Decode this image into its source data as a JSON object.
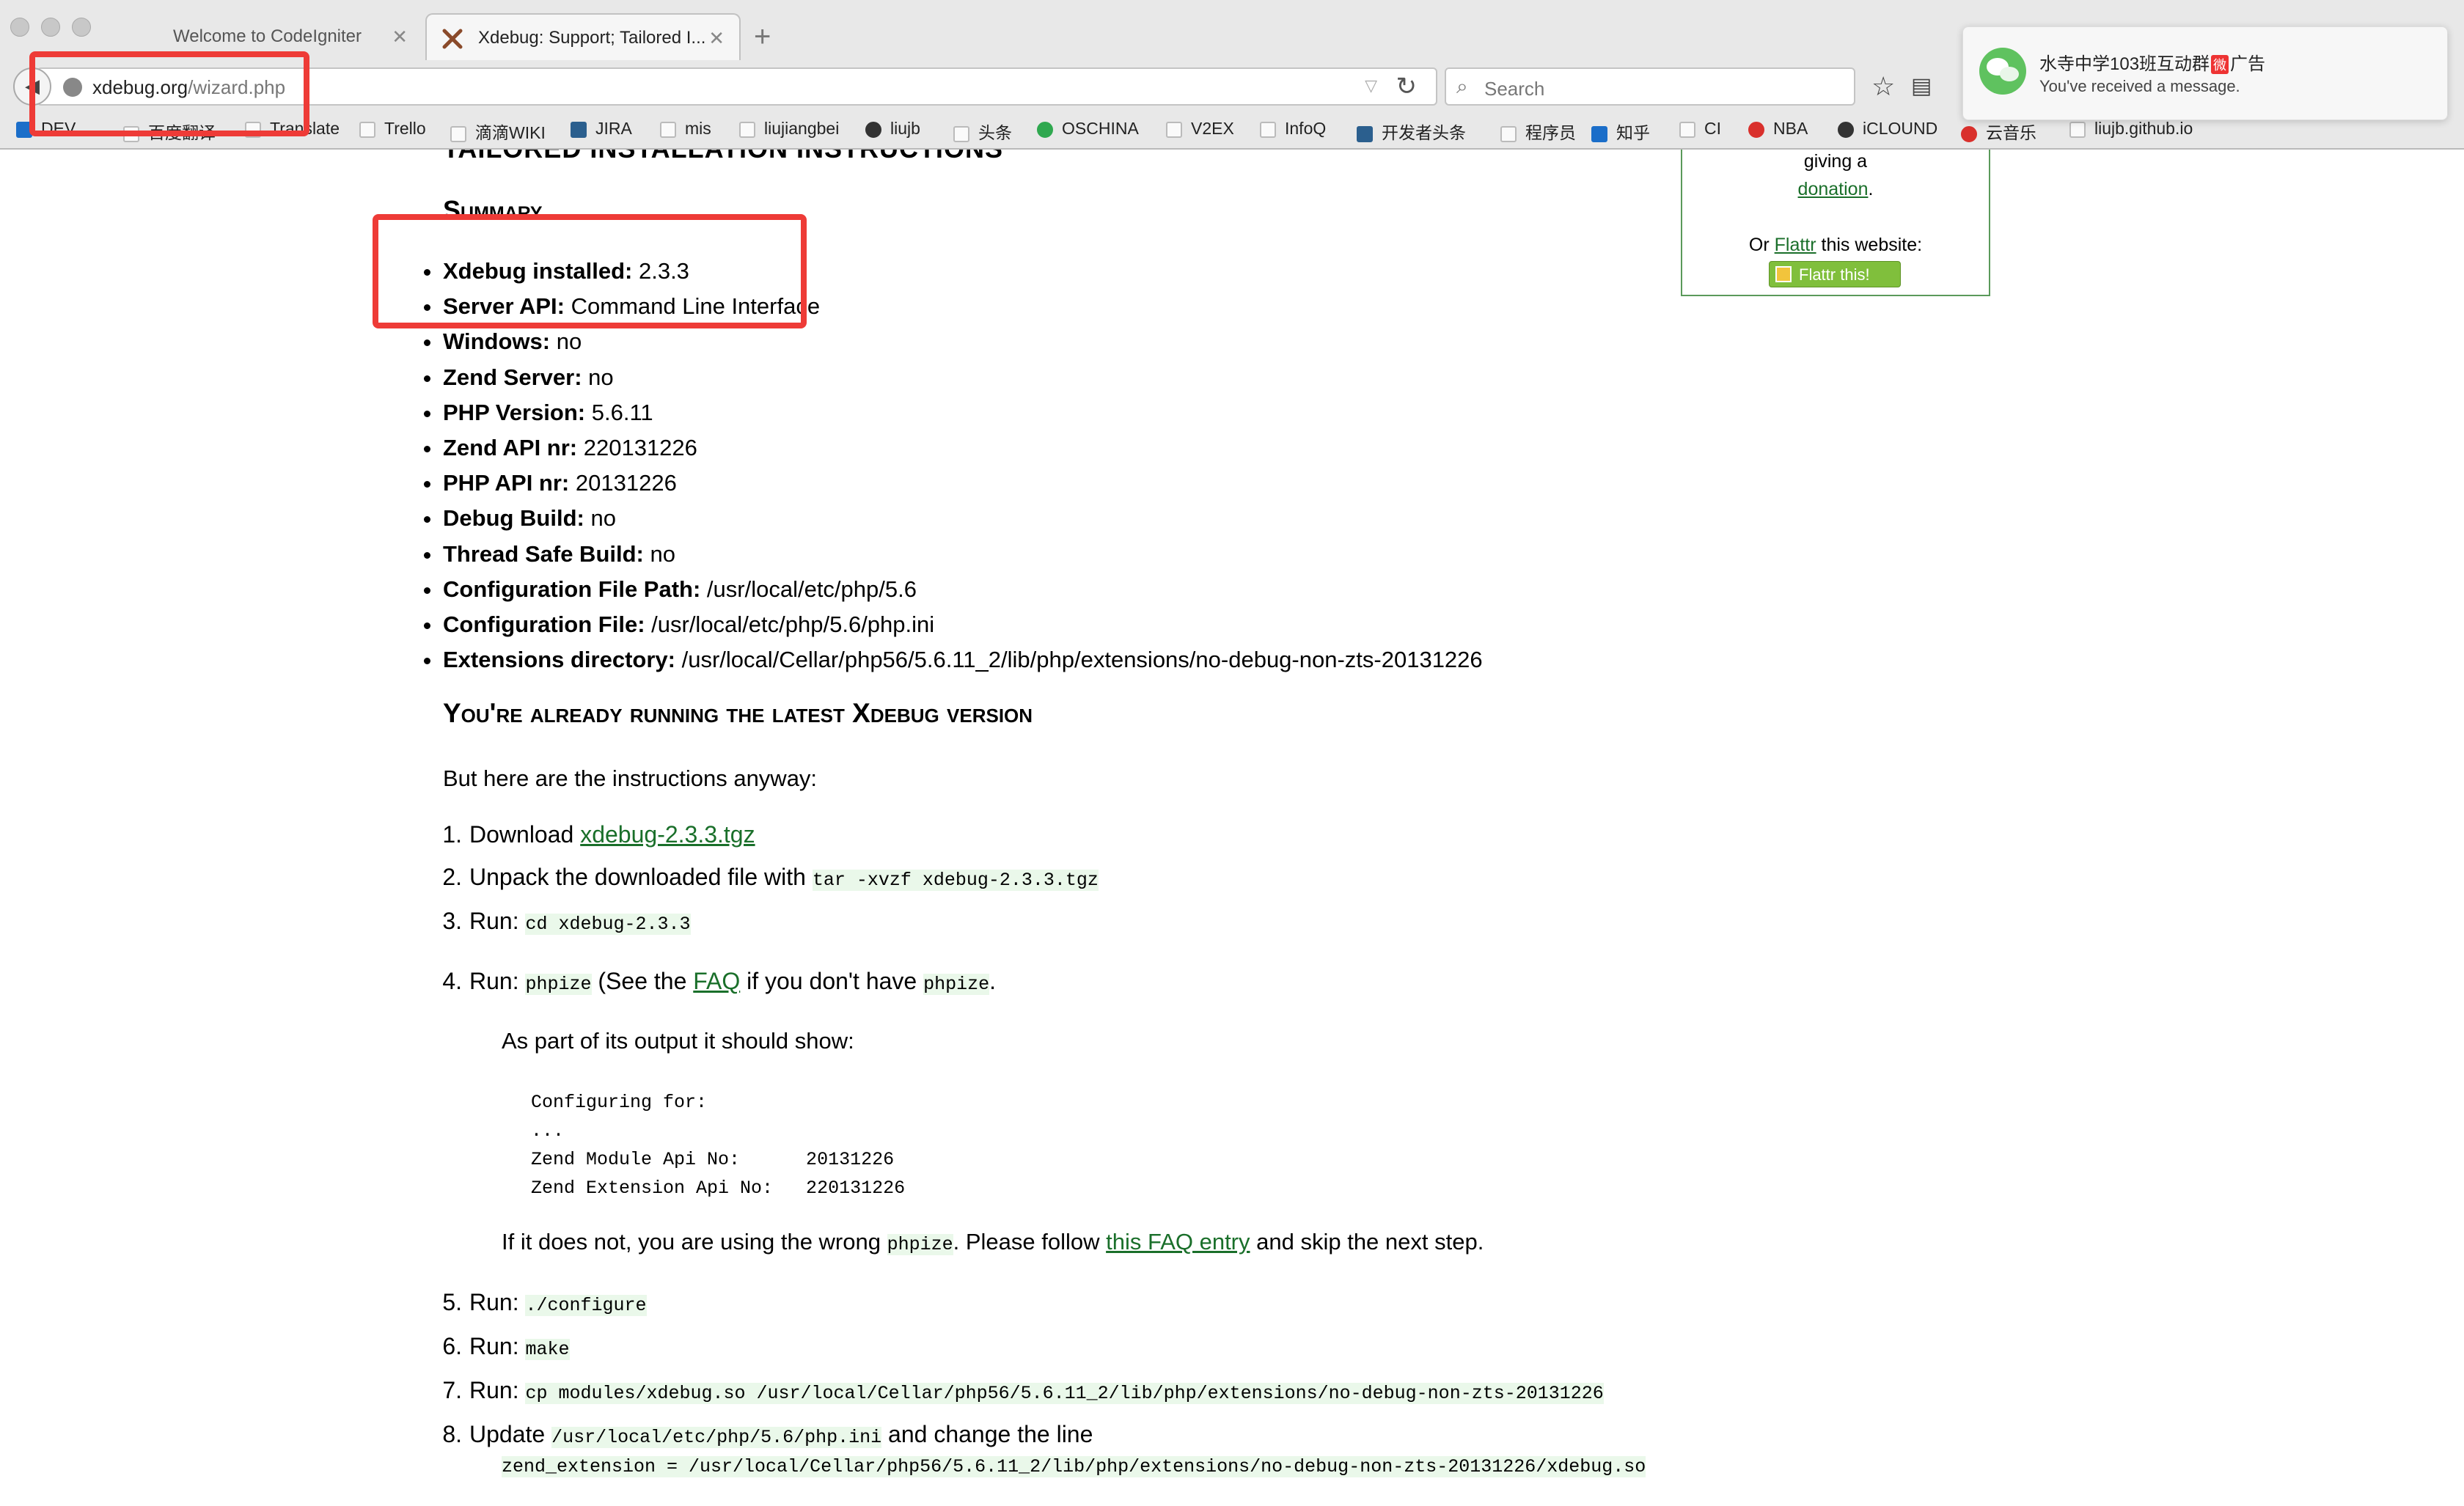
{
  "browser": {
    "tabs": [
      {
        "title": "Welcome to CodeIgniter",
        "close": "✕"
      },
      {
        "title": "Xdebug: Support; Tailored I...",
        "close": "✕"
      }
    ],
    "new_tab": "+",
    "url_host": "xdebug.org",
    "url_path": "/wizard.php",
    "search_placeholder": "Search",
    "bookmarks": [
      "DEV",
      "百度翻译",
      "Translate",
      "Trello",
      "滴滴WIKI",
      "JIRA",
      "mis",
      "liujiangbei",
      "liujb",
      "头条",
      "OSCHINA",
      "V2EX",
      "InfoQ",
      "开发者头条",
      "程序员",
      "知乎",
      "CI",
      "NBA",
      "iCLOUND",
      "云音乐",
      "liujb.github.io"
    ]
  },
  "notification": {
    "title_pre": "水寺中学103班互动群",
    "badge": "微",
    "title_post": "广告",
    "message": "You've received a message."
  },
  "page": {
    "partial_heading": "TAILORED INSTALLATION INSTRUCTIONS",
    "summary_heading": "Summary",
    "summary": [
      {
        "label": "Xdebug installed:",
        "value": " 2.3.3"
      },
      {
        "label": "Server API:",
        "value": " Command Line Interface"
      },
      {
        "label": "Windows:",
        "value": " no"
      },
      {
        "label": "Zend Server:",
        "value": " no"
      },
      {
        "label": "PHP Version:",
        "value": " 5.6.11"
      },
      {
        "label": "Zend API nr:",
        "value": " 220131226"
      },
      {
        "label": "PHP API nr:",
        "value": " 20131226"
      },
      {
        "label": "Debug Build:",
        "value": " no"
      },
      {
        "label": "Thread Safe Build:",
        "value": " no"
      },
      {
        "label": "Configuration File Path:",
        "value": " /usr/local/etc/php/5.6"
      },
      {
        "label": "Configuration File:",
        "value": " /usr/local/etc/php/5.6/php.ini"
      },
      {
        "label": "Extensions directory:",
        "value": " /usr/local/Cellar/php56/5.6.11_2/lib/php/extensions/no-debug-non-zts-20131226"
      }
    ],
    "latest_heading": "You're already running the latest Xdebug version",
    "intro": "But here are the instructions anyway:",
    "steps": {
      "s1_num": "1.",
      "s1_text": "Download ",
      "s1_link": "xdebug-2.3.3.tgz",
      "s2_num": "2.",
      "s2_text": "Unpack the downloaded file with ",
      "s2_code": "tar -xvzf xdebug-2.3.3.tgz",
      "s3_num": "3.",
      "s3_text": "Run: ",
      "s3_code": "cd xdebug-2.3.3",
      "s4_num": "4.",
      "s4_text": "Run: ",
      "s4_code": "phpize",
      "s4_mid": " (See the ",
      "s4_link": "FAQ",
      "s4_after": " if you don't have ",
      "s4_code2": "phpize",
      "s4_end": ".",
      "s4_output_intro": "As part of its output it should show:",
      "s4_output": "Configuring for:\n...\nZend Module Api No:      20131226\nZend Extension Api No:   220131226",
      "s4_else_pre": "If it does not, you are using the wrong ",
      "s4_else_code": "phpize",
      "s4_else_mid": ". Please follow ",
      "s4_else_link": "this FAQ entry",
      "s4_else_post": " and skip the next step.",
      "s5_num": "5.",
      "s5_text": "Run: ",
      "s5_code": "./configure",
      "s6_num": "6.",
      "s6_text": "Run: ",
      "s6_code": "make",
      "s7_num": "7.",
      "s7_text": "Run: ",
      "s7_code": "cp modules/xdebug.so /usr/local/Cellar/php56/5.6.11_2/lib/php/extensions/no-debug-non-zts-20131226",
      "s8_num": "8.",
      "s8_text": "Update ",
      "s8_code": "/usr/local/etc/php/5.6/php.ini",
      "s8_after": " and change the line",
      "s8_line": "zend_extension = /usr/local/Cellar/php56/5.6.11_2/lib/php/extensions/no-debug-non-zts-20131226/xdebug.so"
    },
    "donate": {
      "l1": "giving a",
      "link": "donation",
      "dot": ".",
      "or": "Or ",
      "flattr_link": "Flattr",
      "site": " this website:",
      "button": "Flattr this!"
    }
  },
  "colors": {
    "link": "#1a6f2a",
    "code_bg": "#eaf8ea",
    "annotation": "#ee3b37"
  }
}
